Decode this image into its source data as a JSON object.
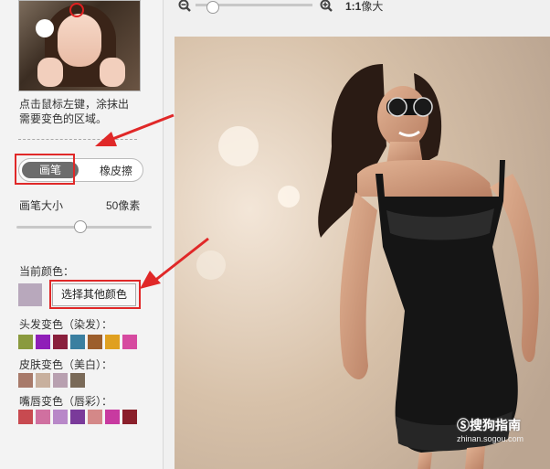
{
  "toolbar": {
    "zoom_label": "1:1",
    "zoom_unit": "像大",
    "zoom_level": 0.15
  },
  "panel": {
    "hint_line1": "点击鼠标左键，涂抹出",
    "hint_line2": "需要变色的区域。",
    "tool_brush": "画笔",
    "tool_eraser": "橡皮擦",
    "active_tool": "画笔",
    "brush_size_label": "画笔大小",
    "brush_size_value": "50像素",
    "brush_size_level": 0.47,
    "current_color_label": "当前颜色：",
    "current_color": "#b8a8bc",
    "pick_other_label": "选择其他颜色",
    "hair_label": "头发变色（染发）：",
    "hair_colors": [
      "#8a9a3e",
      "#8f1fb8",
      "#8a1f3c",
      "#3a7fa0",
      "#9c5e2c",
      "#e0a020",
      "#d64aa0"
    ],
    "skin_label": "皮肤变色（美白）：",
    "skin_colors": [
      "#a87a6a",
      "#c8b09e",
      "#b8a0b0",
      "#7a6a58"
    ],
    "lips_label": "嘴唇变色（唇彩）：",
    "lips_colors": [
      "#c84a50",
      "#d070a0",
      "#b888c8",
      "#7a3a9a",
      "#d48888",
      "#c83aa0",
      "#8a1f2a"
    ]
  },
  "watermark": {
    "title": "搜狗指南",
    "url": "zhinan.sogou.com"
  },
  "icons": {
    "zoom_out": "zoom-out-icon",
    "zoom_in": "zoom-in-icon",
    "annotation_arrow": "red-arrow-icon"
  }
}
